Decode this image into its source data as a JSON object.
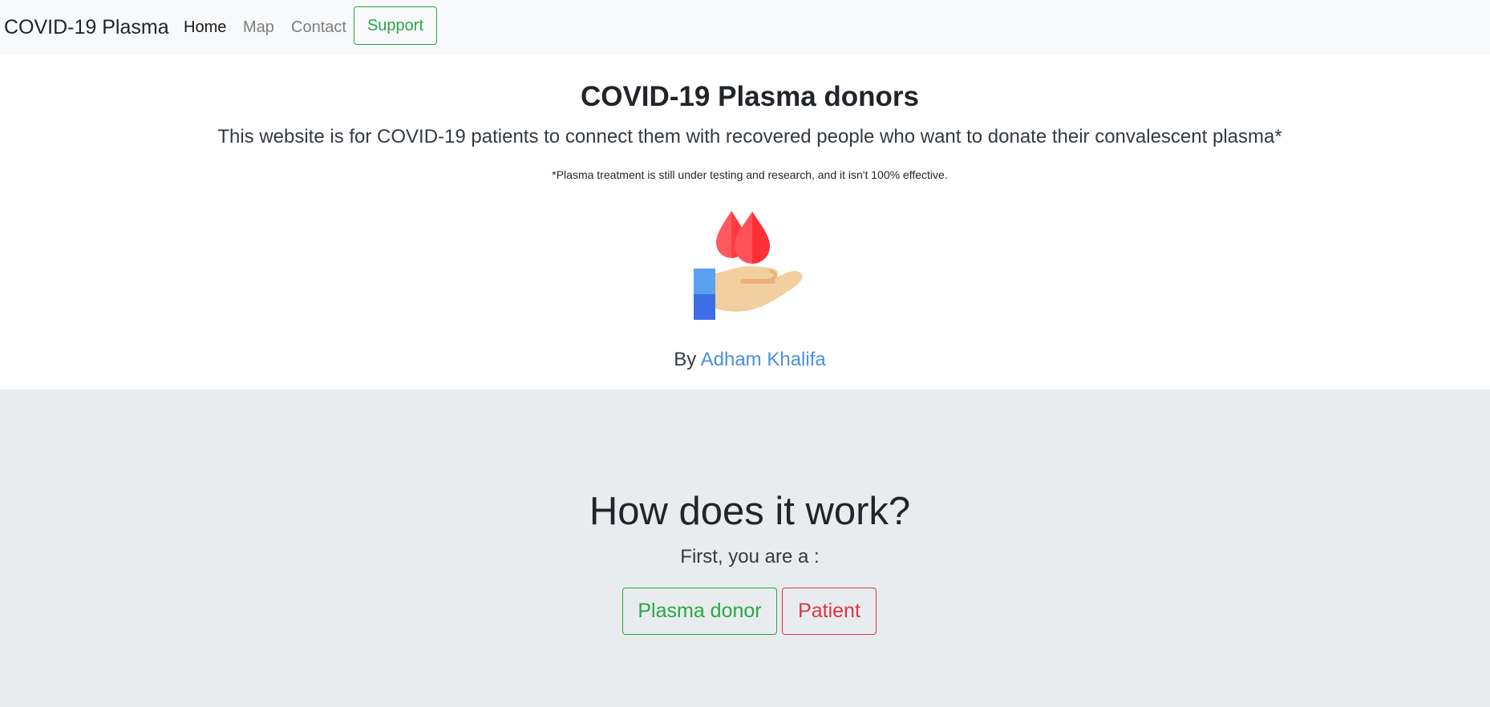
{
  "navbar": {
    "brand": "COVID-19 Plasma",
    "links": [
      {
        "label": "Home"
      },
      {
        "label": "Map"
      },
      {
        "label": "Contact"
      }
    ],
    "support_label": "Support"
  },
  "hero": {
    "title": "COVID-19 Plasma donors",
    "lead": "This website is for COVID-19 patients to connect them with recovered people who want to donate their convalescent plasma*",
    "note": "*Plasma treatment is still under testing and research, and it isn't 100% effective.",
    "logo_icon": "hand-blood-drops-icon",
    "by_prefix": "By",
    "author": "Adham Khalifa"
  },
  "how": {
    "title": "How does it work?",
    "subtitle": "First, you are a :",
    "donor_label": "Plasma donor",
    "patient_label": "Patient"
  },
  "colors": {
    "success": "#28a745",
    "danger": "#dc3545",
    "link": "#4a90e2",
    "navbar_bg": "#f8f9fa",
    "section_bg": "#e9ecef"
  }
}
